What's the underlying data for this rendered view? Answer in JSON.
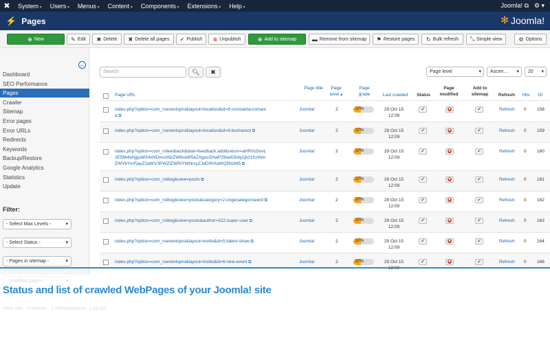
{
  "navbar": {
    "menus": [
      "System",
      "Users",
      "Menus",
      "Content",
      "Components",
      "Extensions",
      "Help"
    ],
    "site_link": "Joomla!"
  },
  "header": {
    "title": "Pages",
    "brand": "Joomla!"
  },
  "toolbar": {
    "new": "New",
    "edit": "Edit",
    "delete": "Delete",
    "delete_all": "Delete all pages",
    "publish": "Publish",
    "unpublish": "Unpublish",
    "add_sitemap": "Add to sitemap",
    "remove_sitemap": "Remove from sitemap",
    "restore": "Restore pages",
    "bulk_refresh": "Bulk refresh",
    "simple_view": "Simple view",
    "options": "Options"
  },
  "sidebar": {
    "items": [
      "Dashboard",
      "SEO Performance",
      "Pages",
      "Crawler",
      "Sitemap",
      "Error pages",
      "Error URLs",
      "Redirects",
      "Keywords",
      "Backup/Restore",
      "Google Analytics",
      "Statistics",
      "Update"
    ],
    "active_index": 2,
    "filter_title": "Filter:",
    "filters": [
      "- Select Max Levels -",
      "- Select Status -",
      "- Pages in sitemap -",
      "- Modified pages -"
    ]
  },
  "search": {
    "placeholder": "Search"
  },
  "list_controls": {
    "order": "Page level",
    "direction": "Ascen...",
    "limit": "20"
  },
  "table": {
    "headers": {
      "url": "Page URL",
      "title": "Page title",
      "level": "Page level",
      "grade": "Page grade",
      "last": "Last crawled",
      "status": "Status",
      "modified": "Page modified",
      "sitemap": "Add to sitemap",
      "refresh": "Refresh",
      "hits": "Hits",
      "id": "ID"
    },
    "rows": [
      {
        "url": "index.php?option=com_rseventspro&layout=location&id=8:constanta-romania",
        "title": "Joomla!",
        "level": "2",
        "grade": "37%",
        "grade_value": 37,
        "date": "29 Oct 15",
        "time": "12:08",
        "status": "ok",
        "modified": "no",
        "sitemap": "ok",
        "refresh": "Refresh",
        "hits": "0",
        "id": "158"
      },
      {
        "url": "index.php?option=com_rseventspro&layout=location&id=6:bucharest",
        "title": "Joomla!",
        "level": "2",
        "grade": "37%",
        "grade_value": 37,
        "date": "29 Oct 15",
        "time": "12:09",
        "status": "ok",
        "modified": "no",
        "sitemap": "ok",
        "refresh": "Refresh",
        "hits": "0",
        "id": "159"
      },
      {
        "url": "index.php?option=com_rsfeedback&task=feedback.add&return=aHR0cDovLzE5Mi4xNjguMS4xNDIvcnNzZW8vaW5kZXgucGhwP29wdGlvbj1jb21fcnNmZWVkYmFjayZ2aWV3PWZlZWRiYWNrcyZJdD0iVtaWQ5NzM5",
        "title": "Joomla!",
        "level": "2",
        "grade": "37%",
        "grade_value": 37,
        "date": "29 Oct 15",
        "time": "12:09",
        "status": "ok",
        "modified": "no",
        "sitemap": "ok",
        "refresh": "Refresh",
        "hits": "0",
        "id": "160"
      },
      {
        "url": "index.php?option=com_rsblog&view=posts",
        "title": "Joomla!",
        "level": "2",
        "grade": "37%",
        "grade_value": 37,
        "date": "29 Oct 15",
        "time": "12:09",
        "status": "ok",
        "modified": "no",
        "sitemap": "ok",
        "refresh": "Refresh",
        "hits": "0",
        "id": "161"
      },
      {
        "url": "index.php?option=com_rsblog&view=posts&category=2:ongecategoriseerd",
        "title": "Joomla!",
        "level": "2",
        "grade": "37%",
        "grade_value": 37,
        "date": "29 Oct 15",
        "time": "12:09",
        "status": "ok",
        "modified": "no",
        "sitemap": "ok",
        "refresh": "Refresh",
        "hits": "0",
        "id": "162"
      },
      {
        "url": "index.php?option=com_rsblog&view=posts&author=322:super-user",
        "title": "Joomla!",
        "level": "2",
        "grade": "37%",
        "grade_value": 37,
        "date": "29 Oct 15",
        "time": "12:09",
        "status": "ok",
        "modified": "no",
        "sitemap": "ok",
        "refresh": "Refresh",
        "hits": "0",
        "id": "163"
      },
      {
        "url": "index.php?option=com_rseventspro&layout=invite&id=5:talent-show",
        "title": "Joomla!",
        "level": "2",
        "grade": "37%",
        "grade_value": 37,
        "date": "29 Oct 15",
        "time": "12:09",
        "status": "ok",
        "modified": "no",
        "sitemap": "ok",
        "refresh": "Refresh",
        "hits": "0",
        "id": "164"
      },
      {
        "url": "index.php?option=com_rseventspro&layout=invite&id=6:new-event",
        "title": "Joomla!",
        "level": "2",
        "grade": "37%",
        "grade_value": 37,
        "date": "29 Oct 15",
        "time": "12:09",
        "status": "ok",
        "modified": "no",
        "sitemap": "ok",
        "refresh": "Refresh",
        "hits": "0",
        "id": "166"
      }
    ]
  },
  "footer_faded": {
    "view_site": "View Site",
    "visitors": "Visitors",
    "admins": "Administrators",
    "logout": "Log out",
    "visitors_count": "0",
    "admins_count": "1"
  },
  "caption": "Status and list of crawled WebPages of your Joomla! site",
  "colors": {
    "accent": "#2a8ad4",
    "header": "#1a3867",
    "navbar": "#17263a",
    "grade": "#f5a623"
  }
}
